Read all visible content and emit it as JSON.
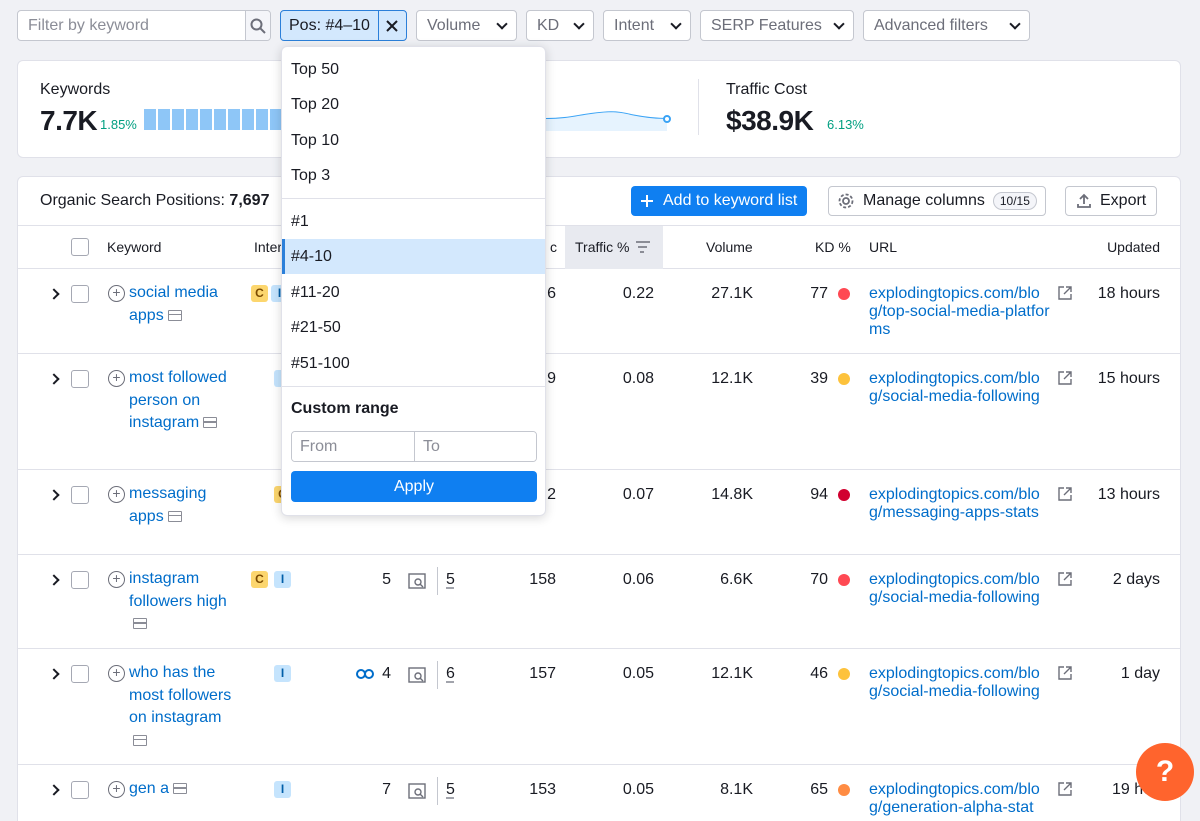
{
  "filters": {
    "search_placeholder": "Filter by keyword",
    "position_chip": "Pos: #4–10",
    "volume": "Volume",
    "kd": "KD",
    "intent": "Intent",
    "serp": "SERP Features",
    "advanced": "Advanced filters"
  },
  "summary": {
    "keywords_label": "Keywords",
    "keywords_value": "7.7K",
    "keywords_change": "1.85%",
    "traffic_cost_label": "Traffic Cost",
    "traffic_cost_value": "$38.9K",
    "traffic_cost_change": "6.13%"
  },
  "table": {
    "title_prefix": "Organic Search Positions: ",
    "title_count": "7,697",
    "add_button": "Add to keyword list",
    "manage_columns": "Manage columns",
    "manage_badge": "10/15",
    "export": "Export",
    "headers": {
      "keyword": "Keyword",
      "intent": "Inter",
      "traffic": "c",
      "traffic_pct": "Traffic %",
      "volume": "Volume",
      "kd": "KD %",
      "url": "URL",
      "updated": "Updated"
    },
    "rows": [
      {
        "keyword": "social media apps",
        "intents": [
          "C",
          "I"
        ],
        "pos": "",
        "serp": "",
        "traffic": "6",
        "traffic_pct": "0.22",
        "volume": "27.1K",
        "kd": "77",
        "kd_color": "#ff4953",
        "url": "explodingtopics.com/blog/top-social-media-platforms",
        "updated": "18 hours"
      },
      {
        "keyword": "most followed person on instagram",
        "intents": [
          "I"
        ],
        "pos": "",
        "serp": "",
        "traffic": "9",
        "traffic_pct": "0.08",
        "volume": "12.1K",
        "kd": "39",
        "kd_color": "#fdc23c",
        "url": "explodingtopics.com/blog/social-media-following",
        "updated": "15 hours"
      },
      {
        "keyword": "messaging apps",
        "intents": [
          "C"
        ],
        "pos": "",
        "serp": "",
        "traffic": "2",
        "traffic_pct": "0.07",
        "volume": "14.8K",
        "kd": "94",
        "kd_color": "#d1002f",
        "url": "explodingtopics.com/blog/messaging-apps-stats",
        "updated": "13 hours"
      },
      {
        "keyword": "instagram followers high",
        "intents": [
          "C",
          "I"
        ],
        "pos": "5",
        "serp": "5",
        "traffic": "158",
        "traffic_pct": "0.06",
        "volume": "6.6K",
        "kd": "70",
        "kd_color": "#ff4953",
        "url": "explodingtopics.com/blog/social-media-following",
        "updated": "2 days"
      },
      {
        "keyword": "who has the most followers on instagram",
        "intents": [
          "I"
        ],
        "pos": "4",
        "serp": "6",
        "traffic": "157",
        "traffic_pct": "0.05",
        "volume": "12.1K",
        "kd": "46",
        "kd_color": "#fdc23c",
        "url": "explodingtopics.com/blog/social-media-following",
        "updated": "1 day"
      },
      {
        "keyword": "gen a",
        "intents": [
          "I"
        ],
        "pos": "7",
        "serp": "5",
        "traffic": "153",
        "traffic_pct": "0.05",
        "volume": "8.1K",
        "kd": "65",
        "kd_color": "#ff8c43",
        "url": "explodingtopics.com/blog/generation-alpha-stat",
        "updated": "19 hou"
      }
    ]
  },
  "dropdown": {
    "items": [
      "Top 50",
      "Top 20",
      "Top 10",
      "Top 3",
      "#1",
      "#4-10",
      "#11-20",
      "#21-50",
      "#51-100"
    ],
    "selected": "#4-10",
    "custom_title": "Custom range",
    "from_placeholder": "From",
    "to_placeholder": "To",
    "apply": "Apply"
  },
  "help": "?",
  "colors": {
    "accent": "#0f7ff1",
    "link": "#006dca",
    "help": "#ff642d",
    "positive": "#009f81"
  }
}
